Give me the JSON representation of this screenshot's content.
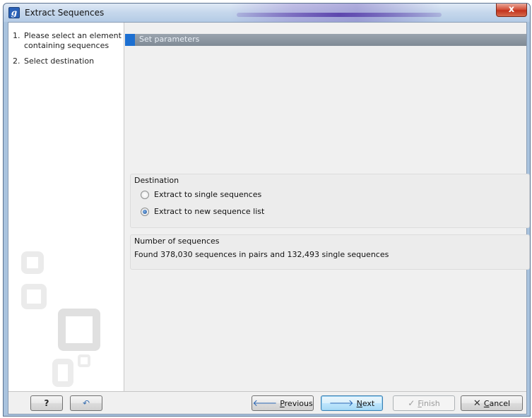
{
  "window": {
    "title": "Extract Sequences",
    "app_icon_letter": "g",
    "close_glyph": "x"
  },
  "steps": [
    {
      "number": "1.",
      "label": "Please select an element containing sequences"
    },
    {
      "number": "2.",
      "label": "Select destination"
    }
  ],
  "content": {
    "header": "Set parameters",
    "destination": {
      "title": "Destination",
      "options": [
        {
          "label": "Extract to single sequences",
          "checked": false
        },
        {
          "label": "Extract to new sequence list",
          "checked": true
        }
      ]
    },
    "count": {
      "title": "Number of sequences",
      "text": "Found 378,030 sequences in pairs and 132,493 single sequences"
    }
  },
  "buttons": {
    "help": {
      "icon": "help-icon",
      "glyph": "?"
    },
    "reset": {
      "icon": "undo-icon",
      "glyph": "↶"
    },
    "previous": {
      "label_u": "P",
      "label_rest": "revious",
      "icon": "arrow-left-icon",
      "glyph": "🡐"
    },
    "next": {
      "label_u": "N",
      "label_rest": "ext",
      "icon": "arrow-right-icon",
      "glyph": "🡒"
    },
    "finish": {
      "label_u": "F",
      "label_rest": "inish",
      "icon": "checkmark-icon",
      "glyph": "✓"
    },
    "cancel": {
      "label_u": "C",
      "label_rest": "ancel",
      "icon": "close-x-icon",
      "glyph": "✕"
    }
  }
}
